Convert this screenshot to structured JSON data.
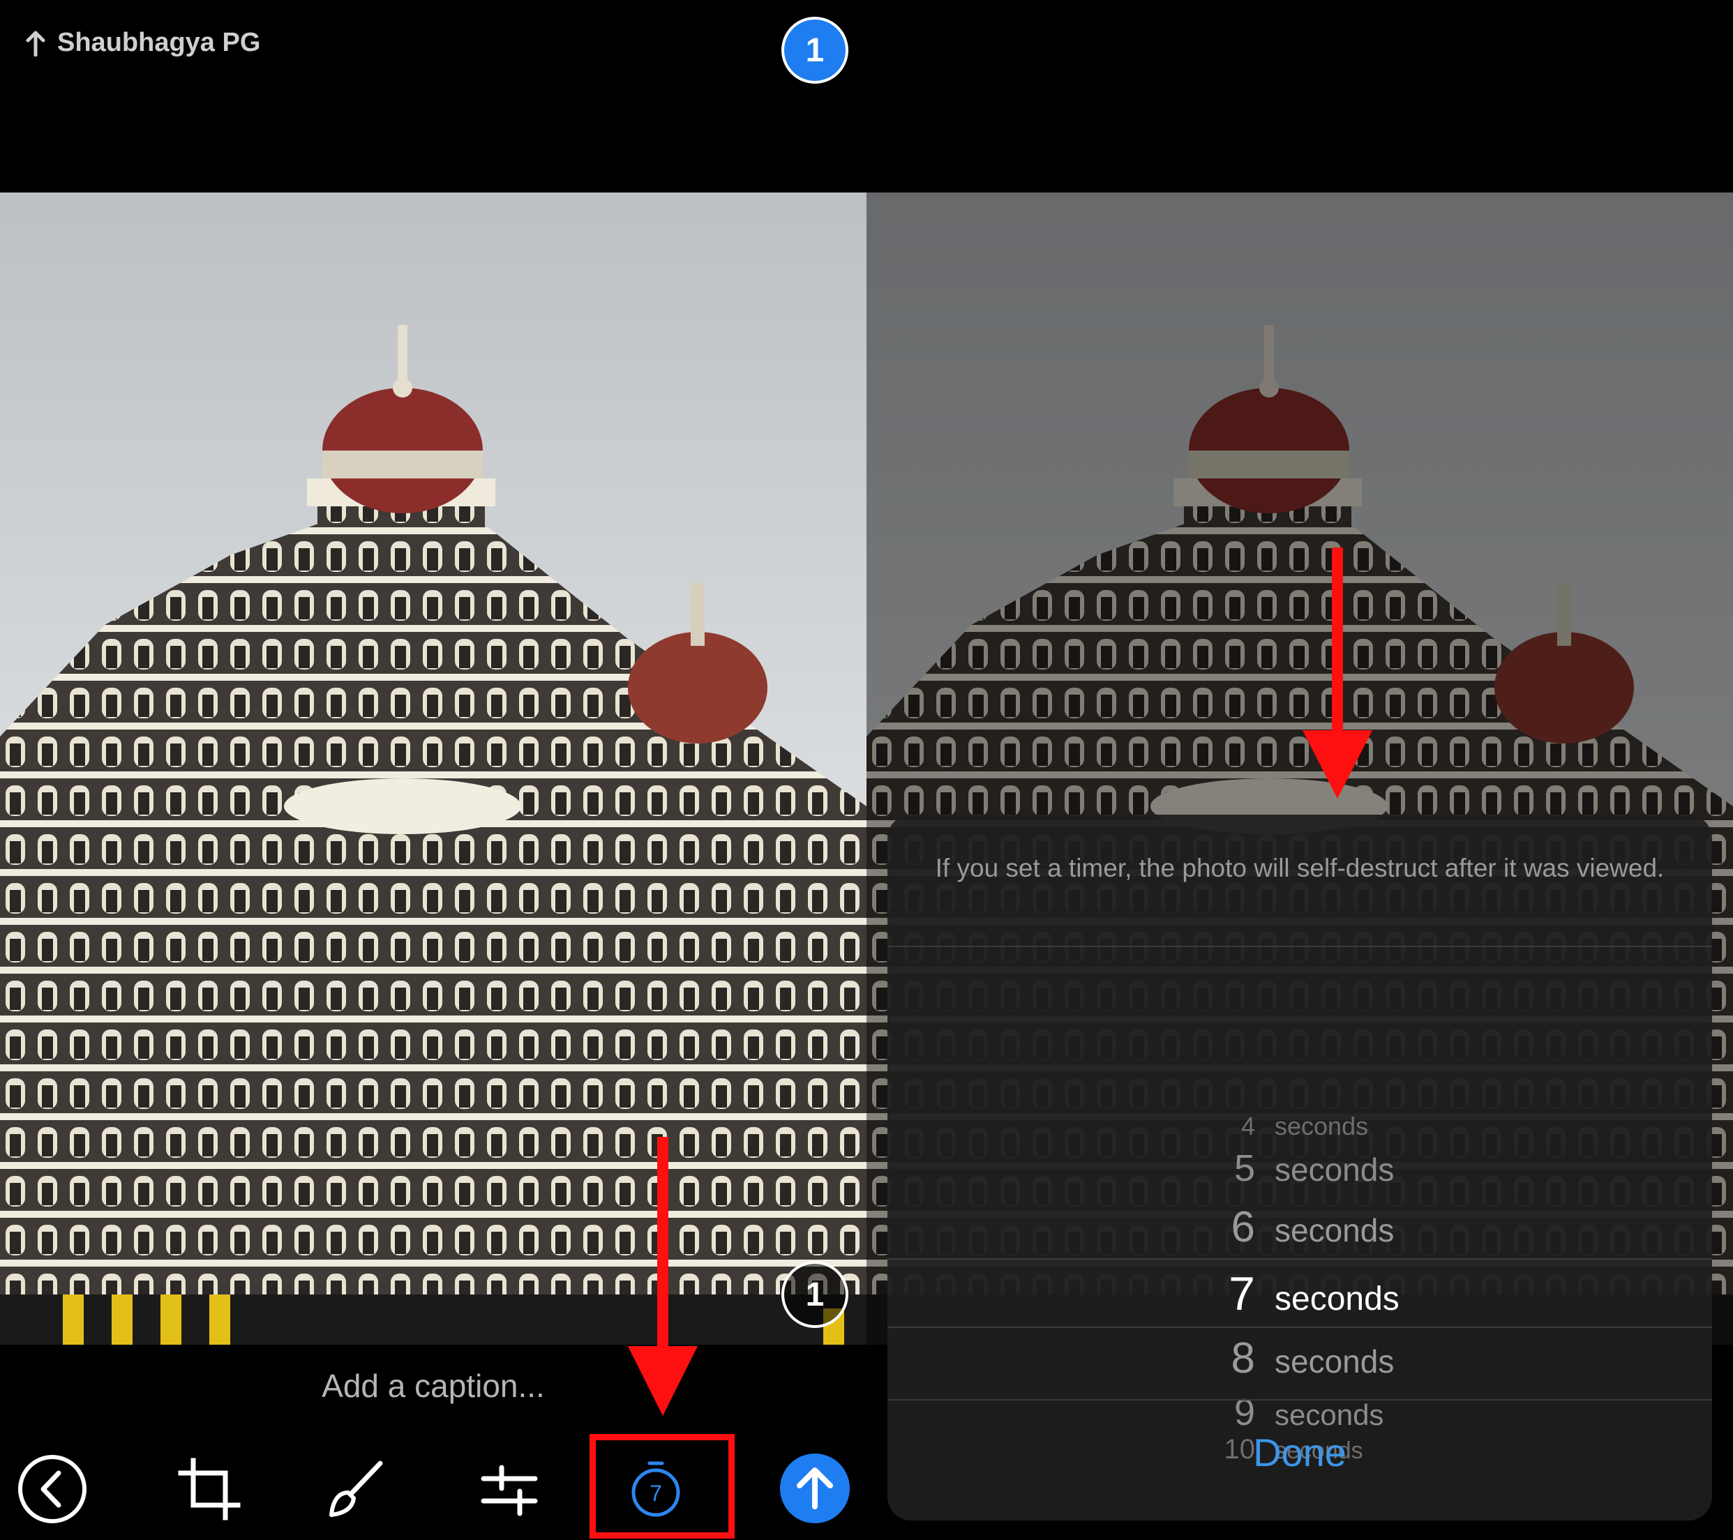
{
  "left": {
    "recipient": "Shaubhagya PG",
    "top_badge": "1",
    "photo_badge": "1",
    "caption_placeholder": "Add a caption...",
    "toolbar": {
      "back_icon": "back-icon",
      "crop_icon": "crop-icon",
      "draw_icon": "brush-icon",
      "adjust_icon": "sliders-icon",
      "timer_icon": "timer-icon",
      "timer_value": "7",
      "send_icon": "send-icon"
    }
  },
  "right": {
    "sheet": {
      "info": "If you set a timer, the photo will self-destruct after it was viewed.",
      "picker": [
        {
          "num": "4",
          "label": "seconds"
        },
        {
          "num": "5",
          "label": "seconds"
        },
        {
          "num": "6",
          "label": "seconds"
        },
        {
          "num": "7",
          "label": "seconds"
        },
        {
          "num": "8",
          "label": "seconds"
        },
        {
          "num": "9",
          "label": "seconds"
        },
        {
          "num": "10",
          "label": "seconds"
        }
      ],
      "selected": "7",
      "done_label": "Done"
    }
  },
  "colors": {
    "accent_blue": "#1e7df0",
    "done_blue": "#3d96ea",
    "annotation_red": "#ff1010"
  }
}
